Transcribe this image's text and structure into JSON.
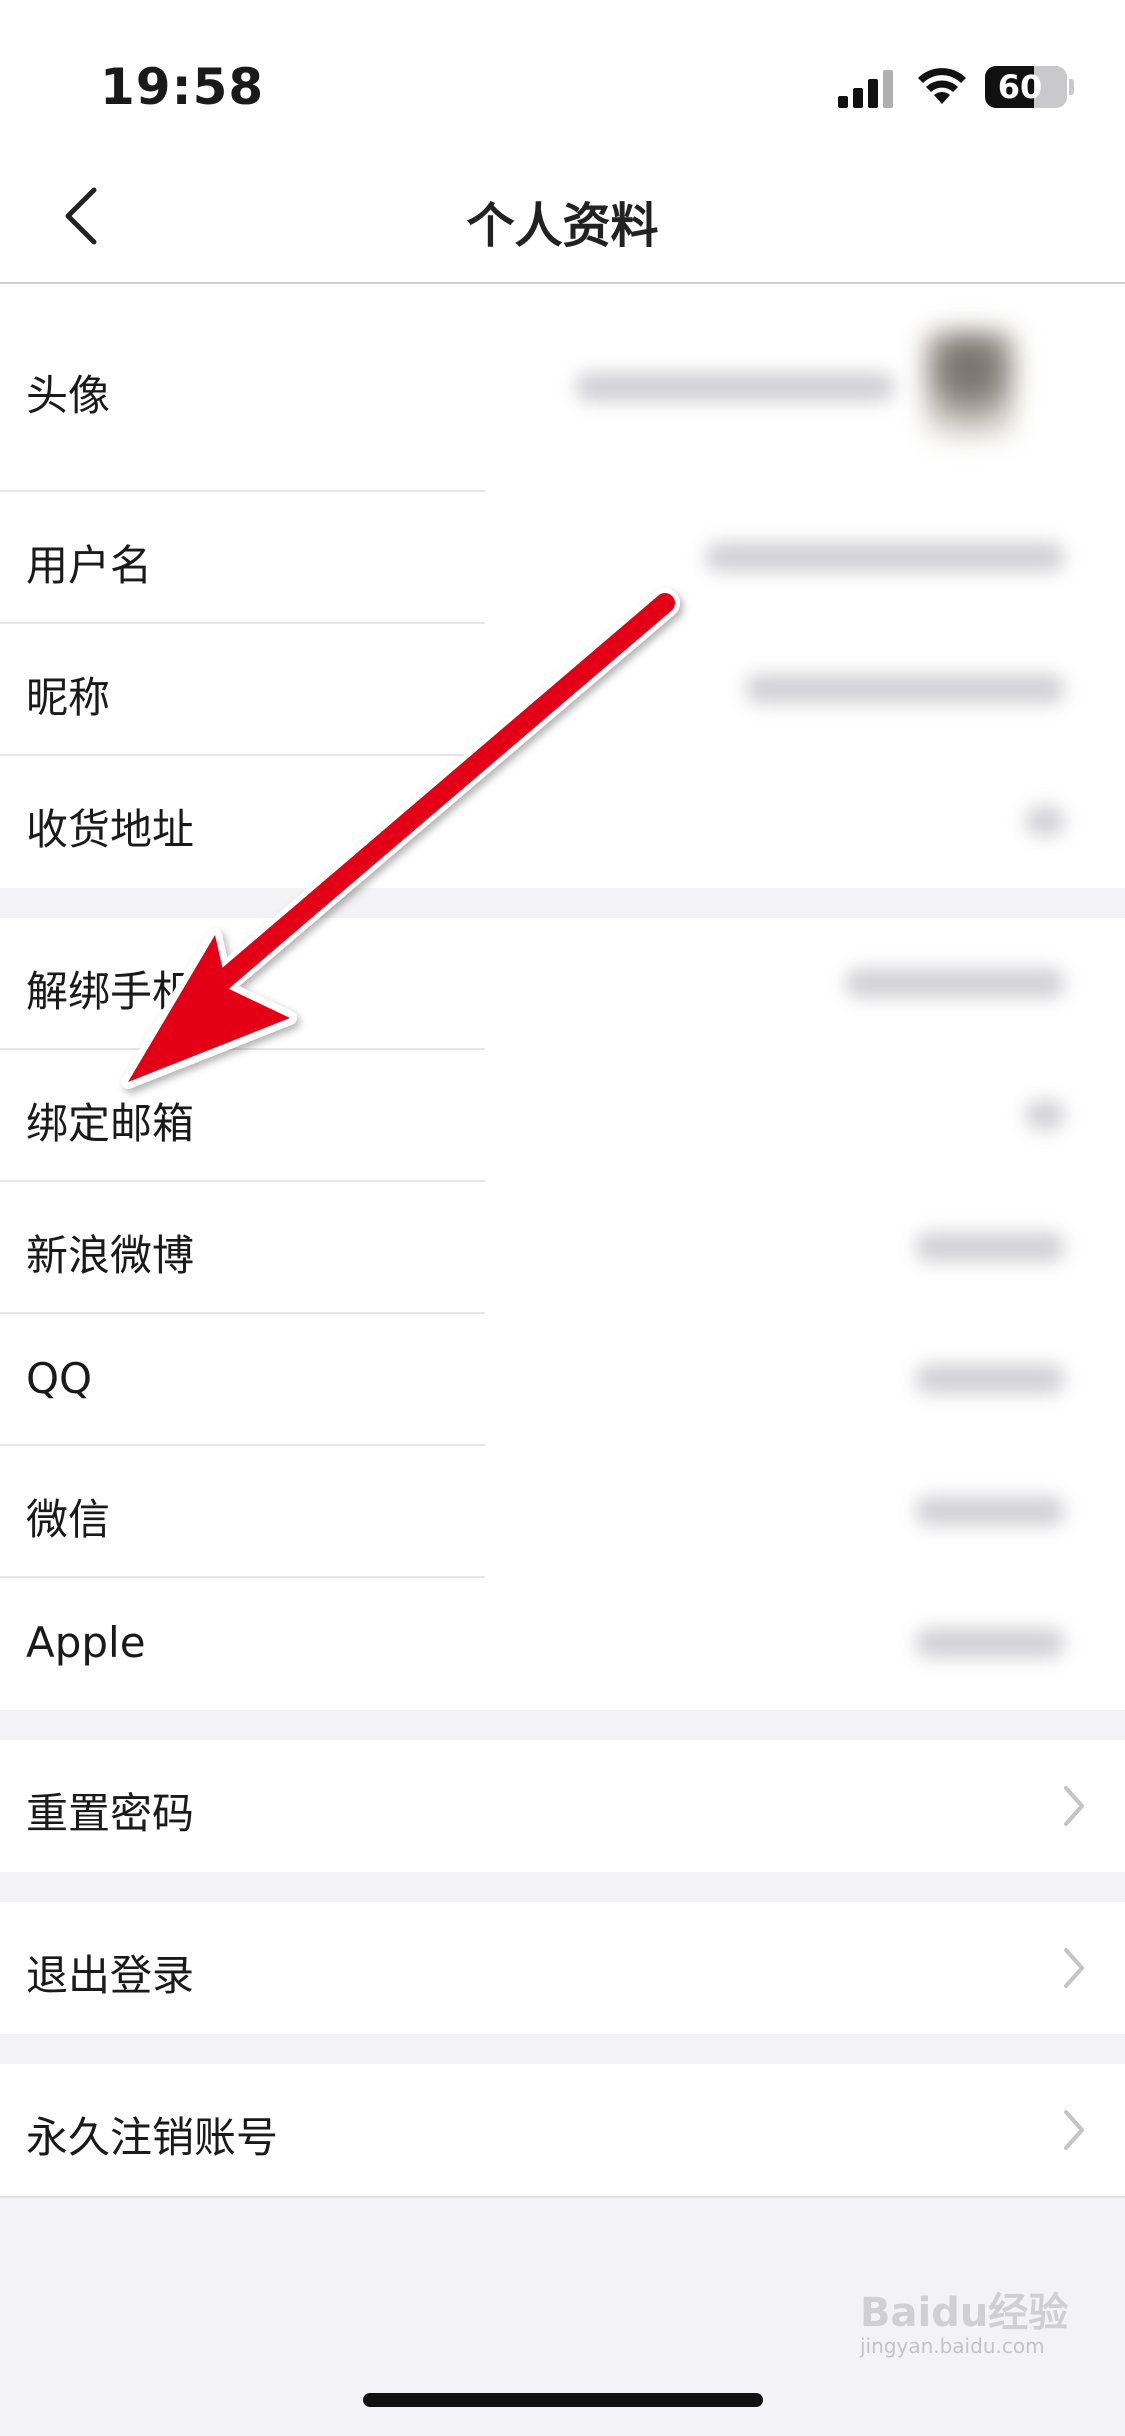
{
  "status_bar": {
    "time": "19:58",
    "battery_level": "60"
  },
  "nav": {
    "title": "个人资料",
    "back_icon": "chevron-left-icon"
  },
  "profile_items": [
    {
      "label": "头像"
    },
    {
      "label": "用户名"
    },
    {
      "label": "昵称"
    },
    {
      "label": "收货地址"
    }
  ],
  "binding_items": [
    {
      "label": "解绑手机"
    },
    {
      "label": "绑定邮箱"
    },
    {
      "label": "新浪微博"
    },
    {
      "label": "QQ"
    },
    {
      "label": "微信"
    },
    {
      "label": "Apple"
    }
  ],
  "actions": [
    {
      "label": "重置密码",
      "icon": "chevron-right-icon"
    },
    {
      "label": "退出登录",
      "icon": "chevron-right-icon"
    },
    {
      "label": "永久注销账号",
      "icon": "chevron-right-icon"
    }
  ],
  "watermark": {
    "brand": "Baidu经验",
    "url": "jingyan.baidu.com"
  },
  "colors": {
    "annotation_arrow": "#e30613",
    "background": "#f3f3f5",
    "row_background": "#ffffff"
  }
}
